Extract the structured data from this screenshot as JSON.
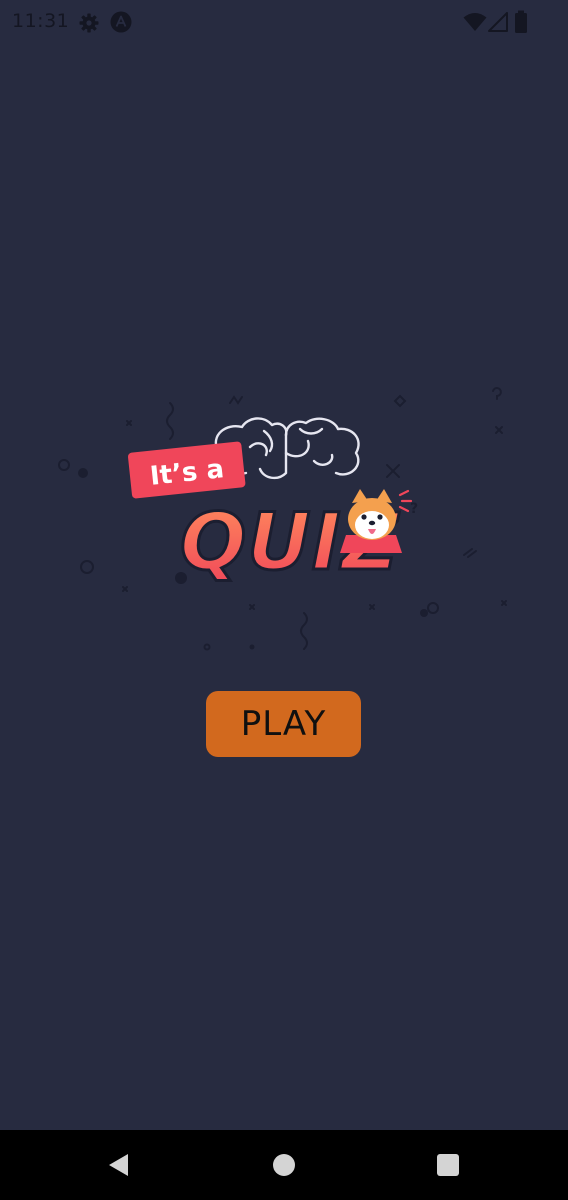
{
  "status_bar": {
    "time": "11:31",
    "icons": [
      "settings-icon",
      "app-notification-icon",
      "wifi-icon",
      "cell-signal-icon",
      "battery-icon"
    ]
  },
  "logo": {
    "line1": "It’s a",
    "line2": "QUIZ",
    "colors": {
      "banner": "#f0465a",
      "quiz_top": "#ff8a5c",
      "quiz_bottom": "#f0465a",
      "outline": "#ffffff"
    }
  },
  "main": {
    "play_label": "PLAY",
    "play_color": "#d2691e"
  },
  "nav": {
    "buttons": [
      "back-icon",
      "home-icon",
      "recents-icon"
    ]
  },
  "colors": {
    "background": "#272b40",
    "status_text": "#141622",
    "nav_bar": "#000000"
  }
}
